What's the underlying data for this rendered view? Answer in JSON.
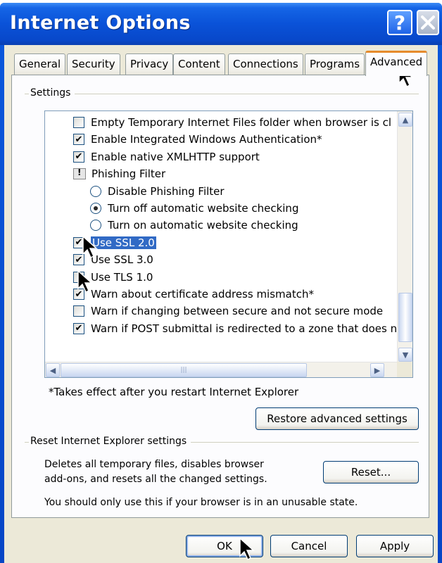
{
  "window": {
    "title": "Internet Options"
  },
  "tabs": [
    {
      "label": "General"
    },
    {
      "label": "Security"
    },
    {
      "label": "Privacy"
    },
    {
      "label": "Content"
    },
    {
      "label": "Connections"
    },
    {
      "label": "Programs"
    },
    {
      "label": "Advanced"
    }
  ],
  "settings": {
    "group_label": "Settings",
    "items": [
      {
        "type": "checkbox",
        "checked": false,
        "label": "Empty Temporary Internet Files folder when browser is cl"
      },
      {
        "type": "checkbox",
        "checked": true,
        "label": "Enable Integrated Windows Authentication*"
      },
      {
        "type": "checkbox",
        "checked": true,
        "label": "Enable native XMLHTTP support"
      },
      {
        "type": "folder",
        "label": "Phishing Filter"
      },
      {
        "type": "radio",
        "selected": false,
        "label": "Disable Phishing Filter"
      },
      {
        "type": "radio",
        "selected": true,
        "label": "Turn off automatic website checking"
      },
      {
        "type": "radio",
        "selected": false,
        "label": "Turn on automatic website checking"
      },
      {
        "type": "checkbox",
        "checked": true,
        "label": "Use SSL 2.0",
        "highlighted": true
      },
      {
        "type": "checkbox",
        "checked": true,
        "label": "Use SSL 3.0"
      },
      {
        "type": "checkbox",
        "checked": false,
        "label": "Use TLS 1.0"
      },
      {
        "type": "checkbox",
        "checked": true,
        "label": "Warn about certificate address mismatch*"
      },
      {
        "type": "checkbox",
        "checked": false,
        "label": "Warn if changing between secure and not secure mode"
      },
      {
        "type": "checkbox",
        "checked": true,
        "label": "Warn if POST submittal is redirected to a zone that does n"
      }
    ]
  },
  "note": "*Takes effect after you restart Internet Explorer",
  "restore_button": "Restore advanced settings",
  "reset_group": {
    "label": "Reset Internet Explorer settings",
    "description": "Deletes all temporary files, disables browser add-ons, and resets all the changed settings.",
    "description_line1": "Deletes all temporary files, disables browser",
    "description_line2": "add-ons, and resets all the changed settings.",
    "reset_button": "Reset...",
    "warning": "You should only use this if your browser is in an unusable state."
  },
  "footer": {
    "ok": "OK",
    "cancel": "Cancel",
    "apply": "Apply"
  },
  "icons": {
    "help": "question-mark-icon",
    "close": "close-x-icon",
    "scroll_up": "chevron-up-icon",
    "scroll_down": "chevron-down-icon",
    "scroll_left": "chevron-left-icon",
    "scroll_right": "chevron-right-icon",
    "cursor": "mouse-pointer-icon"
  },
  "colors": {
    "title_bar": "#0a52d8",
    "face": "#ece9d8",
    "active_tab_accent": "#e68b2c",
    "selection": "#316ac5"
  }
}
